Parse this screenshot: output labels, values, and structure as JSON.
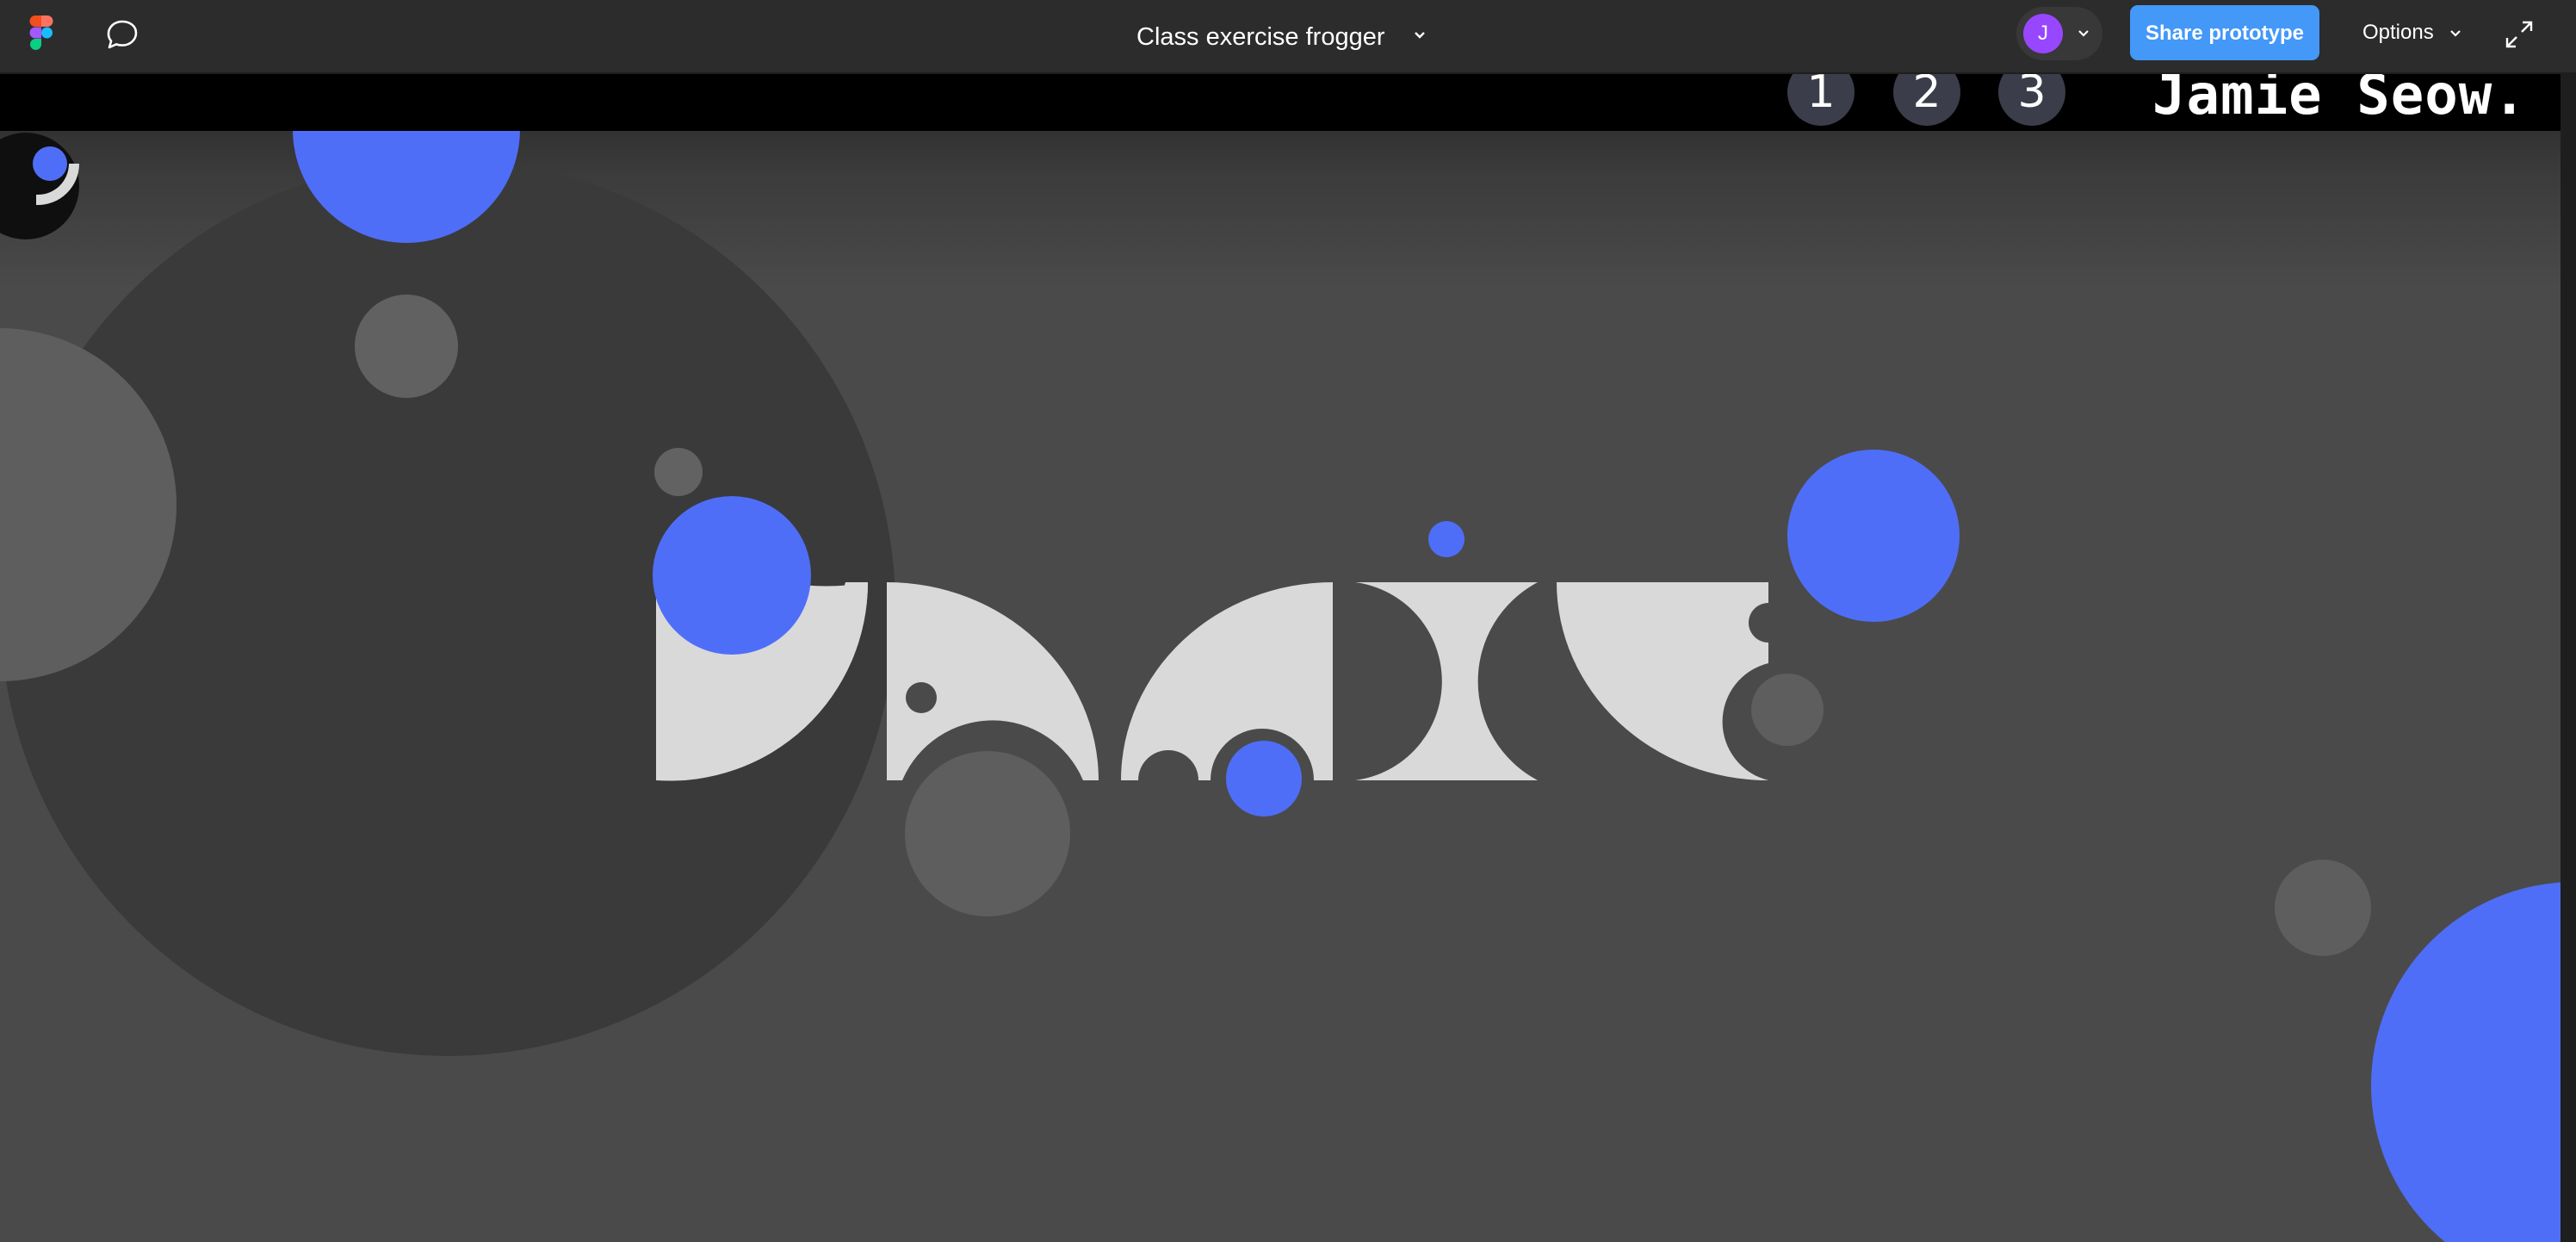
{
  "toolbar": {
    "file_title": "Class exercise frogger",
    "avatar_initial": "J",
    "share_label": "Share prototype",
    "options_label": "Options"
  },
  "icons": {
    "logo": "figma-logo-icon",
    "comment": "comment-bubble-icon",
    "title_menu": "chevron-down-icon",
    "avatar_menu": "chevron-down-icon",
    "options_menu": "chevron-down-icon",
    "expand": "expand-arrows-icon"
  },
  "prototype": {
    "nav_numbers": [
      "1",
      "2",
      "3"
    ],
    "author": "Jamie Seow."
  },
  "colors": {
    "accent_blue": "#4f6ef7",
    "shape_light": "#d9d9d9",
    "shape_gray": "#606060",
    "share_button": "#4398f8",
    "avatar": "#9747ff"
  }
}
